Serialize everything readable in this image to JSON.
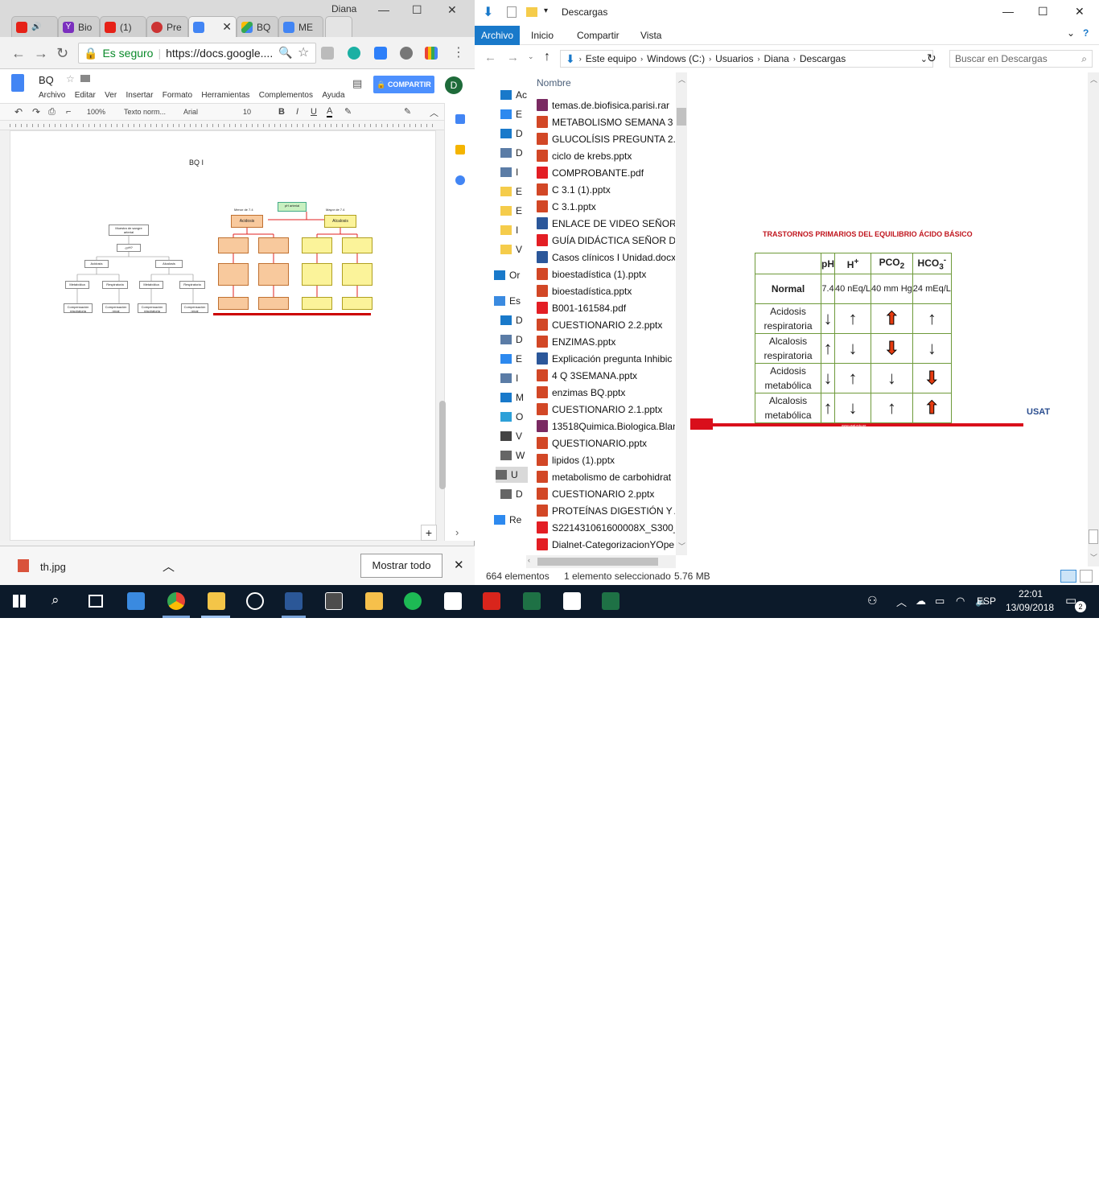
{
  "chrome": {
    "user": "Diana",
    "tabs": [
      {
        "label": "Bio"
      },
      {
        "label": "(1)"
      },
      {
        "label": "Pre"
      },
      {
        "label": ""
      },
      {
        "label": "BQ"
      },
      {
        "label": "ME"
      }
    ],
    "secure_label": "Es seguro",
    "url": "https://docs.google....",
    "doc_title": "BQ",
    "menus": [
      "Archivo",
      "Editar",
      "Ver",
      "Insertar",
      "Formato",
      "Herramientas",
      "Complementos",
      "Ayuda"
    ],
    "share_label": "COMPARTIR",
    "avatar_letter": "D",
    "toolbar": {
      "zoom": "100%",
      "style": "Texto norm...",
      "font": "Arial",
      "size": "10"
    },
    "page_heading": "BQ I",
    "download": {
      "filename": "th.jpg",
      "show_all": "Mostrar todo"
    },
    "flowchart": {
      "root": "Muestra de sangre arterial",
      "q": "¿pH?",
      "acidosis": "Acidosis",
      "alcalosis": "Alcalosis",
      "metabolica": "Metabólica",
      "respiratoria": "Respiratoria",
      "comp_resp": "Compensación respiratoria",
      "comp_renal": "Compensación renal",
      "ph_arterial": "pH arterial",
      "menor": "Menor de 7.4",
      "mayor": "Mayor de 7.4",
      "acidosis_b": "Acidosis",
      "alcalosis_b": "Alcalosis"
    }
  },
  "explorer": {
    "title": "Descargas",
    "ribbon_tabs": [
      "Archivo",
      "Inicio",
      "Compartir",
      "Vista"
    ],
    "address": [
      "Este equipo",
      "Windows (C:)",
      "Usuarios",
      "Diana",
      "Descargas"
    ],
    "search_placeholder": "Buscar en Descargas",
    "column_header": "Nombre",
    "nav_items": [
      "Ac",
      "E",
      "D",
      "D",
      "I",
      "E",
      "E",
      "I",
      "V",
      "Or",
      "Es",
      "D",
      "D",
      "E",
      "I",
      "M",
      "O",
      "V",
      "W",
      "U",
      "D",
      "Re"
    ],
    "files": [
      {
        "name": "temas.de.biofisica.parisi.rar",
        "type": "rar"
      },
      {
        "name": "METABOLISMO SEMANA 3 S",
        "type": "ppt"
      },
      {
        "name": "GLUCOLÍSIS PREGUNTA 2.ppt",
        "type": "ppt"
      },
      {
        "name": "ciclo de krebs.pptx",
        "type": "ppt"
      },
      {
        "name": "COMPROBANTE.pdf",
        "type": "pdf"
      },
      {
        "name": "C 3.1 (1).pptx",
        "type": "ppt"
      },
      {
        "name": "C 3.1.pptx",
        "type": "ppt"
      },
      {
        "name": "ENLACE DE VIDEO SEÑOR DO",
        "type": "doc"
      },
      {
        "name": "GUÍA DIDÁCTICA SEÑOR DO",
        "type": "pdf"
      },
      {
        "name": "Casos clínicos I Unidad.docx",
        "type": "doc"
      },
      {
        "name": "bioestadística (1).pptx",
        "type": "ppt"
      },
      {
        "name": "bioestadística.pptx",
        "type": "ppt"
      },
      {
        "name": "B001-161584.pdf",
        "type": "pdf"
      },
      {
        "name": "CUESTIONARIO 2.2.pptx",
        "type": "ppt"
      },
      {
        "name": "ENZIMAS.pptx",
        "type": "ppt"
      },
      {
        "name": "Explicación pregunta Inhibic",
        "type": "doc"
      },
      {
        "name": "4 Q 3SEMANA.pptx",
        "type": "ppt"
      },
      {
        "name": "enzimas BQ.pptx",
        "type": "ppt"
      },
      {
        "name": "CUESTIONARIO 2.1.pptx",
        "type": "ppt"
      },
      {
        "name": "13518Quimica.Biologica.Blan",
        "type": "rar"
      },
      {
        "name": "QUESTIONARIO.pptx",
        "type": "ppt"
      },
      {
        "name": "lipidos (1).pptx",
        "type": "ppt"
      },
      {
        "name": "metabolismo de carbohidrat",
        "type": "ppt"
      },
      {
        "name": "CUESTIONARIO 2.pptx",
        "type": "ppt"
      },
      {
        "name": "PROTEÍNAS DIGESTIÓN Y AB",
        "type": "ppt"
      },
      {
        "name": "S221431061600008X_S300_es.",
        "type": "pdf"
      },
      {
        "name": "Dialnet-CategorizacionYOpe",
        "type": "pdf"
      }
    ],
    "status": {
      "count": "664 elementos",
      "selected": "1 elemento seleccionado",
      "size": "5.76 MB"
    },
    "preview": {
      "title": "TRASTORNOS PRIMARIOS DEL EQUILIBRIO ÁCIDO BÁSICO",
      "headers": [
        "pH",
        "H+",
        "PCO2",
        "HCO3-"
      ],
      "normal": {
        "label": "Normal",
        "values": [
          "7.4",
          "40 nEq/L",
          "40 mm Hg",
          "24 mEq/L"
        ]
      },
      "rows": [
        {
          "label": "Acidosis respiratoria",
          "arrows": [
            "down",
            "up",
            "up-red",
            "up"
          ]
        },
        {
          "label": "Alcalosis respiratoria",
          "arrows": [
            "up",
            "down",
            "down-red",
            "down"
          ]
        },
        {
          "label": "Acidosis metabólica",
          "arrows": [
            "down",
            "up",
            "down",
            "down-red"
          ]
        },
        {
          "label": "Alcalosis metabólica",
          "arrows": [
            "up",
            "down",
            "up",
            "up-red"
          ]
        }
      ],
      "footer_url": "www.usat.edu.pe",
      "logo": "USAT"
    }
  },
  "taskbar": {
    "lang": "ESP",
    "time": "22:01",
    "date": "13/09/2018",
    "notif_count": "2"
  }
}
